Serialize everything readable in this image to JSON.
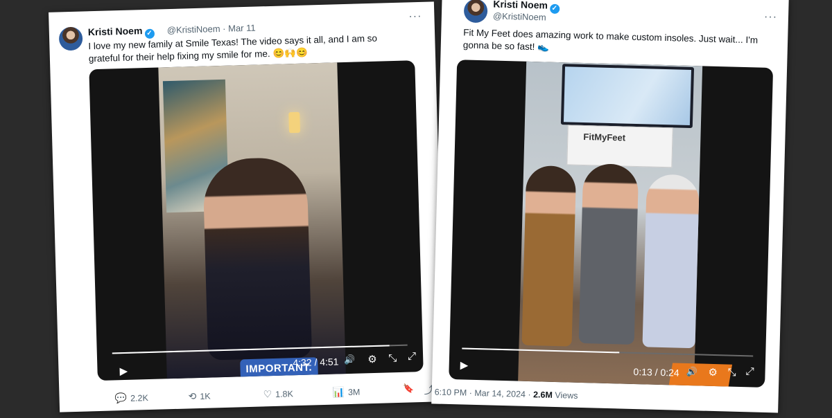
{
  "tweet1": {
    "name": "Kristi Noem",
    "handle": "@KristiNoem",
    "date": "Mar 11",
    "text_line1": "I love my new family at Smile Texas! The video says it all, and I am so",
    "text_line2": "grateful for their help fixing my smile for me. 😊🙌😊",
    "caption": "IMPORTANT.",
    "time_display": "4:32 / 4:51",
    "progress": 0.94,
    "replies": "2.2K",
    "reposts": "1K",
    "likes": "1.8K",
    "views": "3M"
  },
  "tweet2": {
    "name": "Kristi Noem",
    "handle": "@KristiNoem",
    "text_line1": "Fit My Feet does amazing work to make custom insoles. Just wait... I'm",
    "text_line2": "gonna be so fast! 👟",
    "sign_text": "FitMyFeet",
    "time_display": "0:13 / 0:24",
    "progress": 0.54,
    "timestamp": "6:10 PM · Mar 14, 2024 ·",
    "views_count": "2.6M",
    "views_label": "Views"
  },
  "icons": {
    "play": "▶",
    "volume": "🔊",
    "settings": "⚙",
    "minimize": "⤡",
    "fullscreen": "⤢",
    "reply": "💬",
    "repost": "⟲",
    "like": "♡",
    "stats": "📊",
    "bookmark": "🔖",
    "share": "⤴",
    "more": "···",
    "verified": "✓"
  },
  "colors": {
    "verified": "#1d9bf0",
    "caption_pill": "#3361b8"
  }
}
